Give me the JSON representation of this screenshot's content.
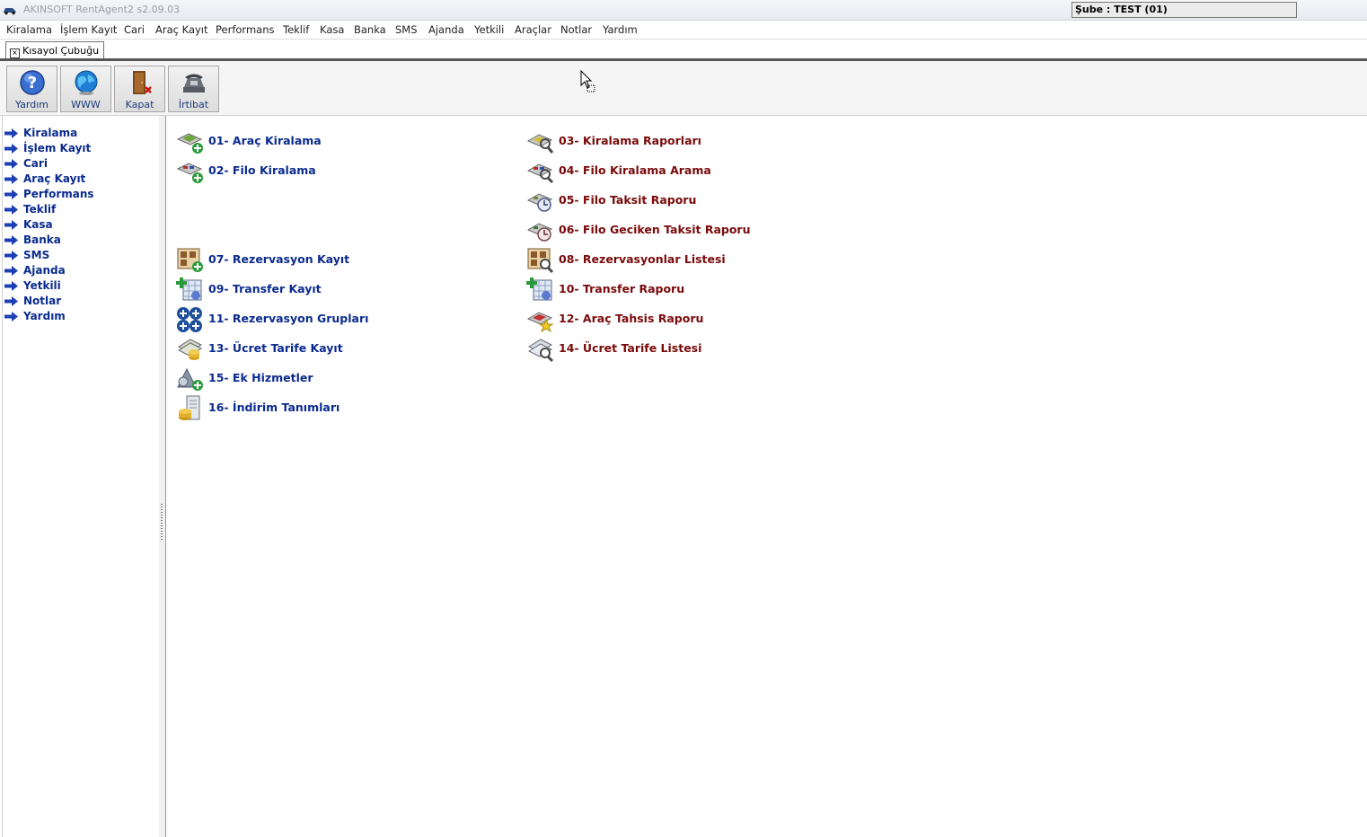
{
  "window": {
    "title": "AKINSOFT RentAgent2 s2.09.03",
    "branch": "Şube : TEST (01)"
  },
  "menu": [
    "Kiralama",
    "İşlem Kayıt",
    "Cari",
    "Araç Kayıt",
    "Performans",
    "Teklif",
    "Kasa",
    "Banka",
    "SMS",
    "Ajanda",
    "Yetkili",
    "Araçlar",
    "Notlar",
    "Yardım"
  ],
  "tab": {
    "label": "Kısayol Çubuğu",
    "close": "×"
  },
  "toolbar": [
    {
      "label": "Yardım",
      "icon": "help-icon"
    },
    {
      "label": "WWW",
      "icon": "globe-icon"
    },
    {
      "label": "Kapat",
      "icon": "door-icon"
    },
    {
      "label": "İrtibat",
      "icon": "phone-icon"
    }
  ],
  "sidebar": [
    "Kiralama",
    "İşlem Kayıt",
    "Cari",
    "Araç Kayıt",
    "Performans",
    "Teklif",
    "Kasa",
    "Banka",
    "SMS",
    "Ajanda",
    "Yetkili",
    "Notlar",
    "Yardım"
  ],
  "shortcuts_left": [
    {
      "label": "01- Araç Kiralama",
      "icon": "car-add-icon"
    },
    {
      "label": "02- Filo Kiralama",
      "icon": "fleet-add-icon"
    },
    {
      "label": "07- Rezervasyon Kayıt",
      "icon": "reservation-add-icon"
    },
    {
      "label": "09- Transfer Kayıt",
      "icon": "transfer-add-icon"
    },
    {
      "label": "11- Rezervasyon Grupları",
      "icon": "groups-icon"
    },
    {
      "label": "13- Ücret Tarife Kayıt",
      "icon": "tariff-add-icon"
    },
    {
      "label": "15- Ek Hizmetler",
      "icon": "services-icon"
    },
    {
      "label": "16- İndirim Tanımları",
      "icon": "discount-icon"
    }
  ],
  "shortcuts_right": [
    {
      "label": "03- Kiralama Raporları",
      "icon": "rental-report-icon"
    },
    {
      "label": "04- Filo Kiralama Arama",
      "icon": "fleet-search-icon"
    },
    {
      "label": "05- Filo Taksit Raporu",
      "icon": "installment-report-icon"
    },
    {
      "label": "06- Filo Geciken Taksit Raporu",
      "icon": "late-installment-icon"
    },
    {
      "label": "08- Rezervasyonlar Listesi",
      "icon": "reservation-list-icon"
    },
    {
      "label": "10- Transfer Raporu",
      "icon": "transfer-report-icon"
    },
    {
      "label": "12- Araç Tahsis Raporu",
      "icon": "allocation-report-icon"
    },
    {
      "label": "14- Ücret Tarife Listesi",
      "icon": "tariff-list-icon"
    }
  ],
  "colors": {
    "nav_blue": "#0b2b8f",
    "report_red": "#7a0a0a"
  }
}
